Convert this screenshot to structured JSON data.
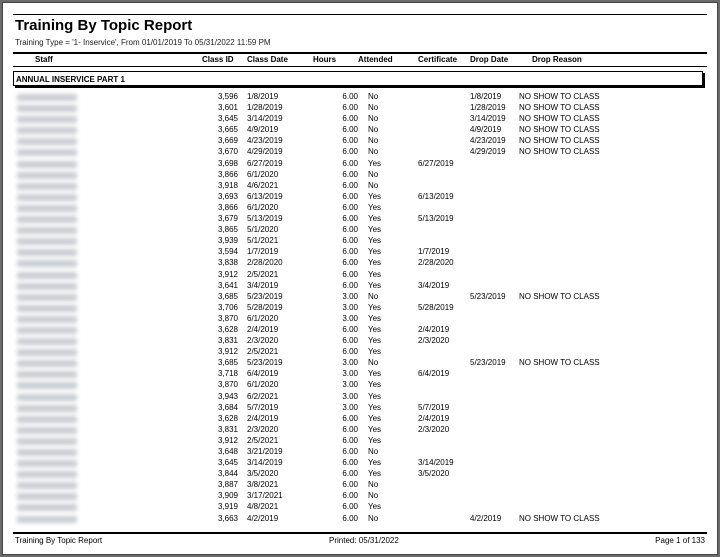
{
  "report": {
    "title": "Training By Topic Report",
    "subtitle": "Training Type  = '1- Inservice', From 01/01/2019 To 05/31/2022 11:59 PM"
  },
  "columns": {
    "staff": "Staff",
    "class_id": "Class ID",
    "class_date": "Class Date",
    "hours": "Hours",
    "attended": "Attended",
    "certificate": "Certificate",
    "drop_date": "Drop Date",
    "drop_reason": "Drop Reason"
  },
  "section": {
    "title": "ANNUAL INSERVICE PART 1"
  },
  "rows": [
    {
      "class_id": "3,596",
      "class_date": "1/8/2019",
      "hours": "6.00",
      "attended": "No",
      "certificate": "",
      "drop_date": "1/8/2019",
      "drop_reason": "NO SHOW TO CLASS"
    },
    {
      "class_id": "3,601",
      "class_date": "1/28/2019",
      "hours": "6.00",
      "attended": "No",
      "certificate": "",
      "drop_date": "1/28/2019",
      "drop_reason": "NO SHOW TO CLASS"
    },
    {
      "class_id": "3,645",
      "class_date": "3/14/2019",
      "hours": "6.00",
      "attended": "No",
      "certificate": "",
      "drop_date": "3/14/2019",
      "drop_reason": "NO SHOW TO CLASS"
    },
    {
      "class_id": "3,665",
      "class_date": "4/9/2019",
      "hours": "6.00",
      "attended": "No",
      "certificate": "",
      "drop_date": "4/9/2019",
      "drop_reason": "NO SHOW TO CLASS"
    },
    {
      "class_id": "3,669",
      "class_date": "4/23/2019",
      "hours": "6.00",
      "attended": "No",
      "certificate": "",
      "drop_date": "4/23/2019",
      "drop_reason": "NO SHOW TO CLASS"
    },
    {
      "class_id": "3,670",
      "class_date": "4/29/2019",
      "hours": "6.00",
      "attended": "No",
      "certificate": "",
      "drop_date": "4/29/2019",
      "drop_reason": "NO SHOW TO CLASS"
    },
    {
      "class_id": "3,698",
      "class_date": "6/27/2019",
      "hours": "6.00",
      "attended": "Yes",
      "certificate": "6/27/2019",
      "drop_date": "",
      "drop_reason": ""
    },
    {
      "class_id": "3,866",
      "class_date": "6/1/2020",
      "hours": "6.00",
      "attended": "No",
      "certificate": "",
      "drop_date": "",
      "drop_reason": ""
    },
    {
      "class_id": "3,918",
      "class_date": "4/6/2021",
      "hours": "6.00",
      "attended": "No",
      "certificate": "",
      "drop_date": "",
      "drop_reason": ""
    },
    {
      "class_id": "3,693",
      "class_date": "6/13/2019",
      "hours": "6.00",
      "attended": "Yes",
      "certificate": "6/13/2019",
      "drop_date": "",
      "drop_reason": ""
    },
    {
      "class_id": "3,866",
      "class_date": "6/1/2020",
      "hours": "6.00",
      "attended": "Yes",
      "certificate": "",
      "drop_date": "",
      "drop_reason": ""
    },
    {
      "class_id": "3,679",
      "class_date": "5/13/2019",
      "hours": "6.00",
      "attended": "Yes",
      "certificate": "5/13/2019",
      "drop_date": "",
      "drop_reason": ""
    },
    {
      "class_id": "3,865",
      "class_date": "5/1/2020",
      "hours": "6.00",
      "attended": "Yes",
      "certificate": "",
      "drop_date": "",
      "drop_reason": ""
    },
    {
      "class_id": "3,939",
      "class_date": "5/1/2021",
      "hours": "6.00",
      "attended": "Yes",
      "certificate": "",
      "drop_date": "",
      "drop_reason": ""
    },
    {
      "class_id": "3,594",
      "class_date": "1/7/2019",
      "hours": "6.00",
      "attended": "Yes",
      "certificate": "1/7/2019",
      "drop_date": "",
      "drop_reason": ""
    },
    {
      "class_id": "3,838",
      "class_date": "2/28/2020",
      "hours": "6.00",
      "attended": "Yes",
      "certificate": "2/28/2020",
      "drop_date": "",
      "drop_reason": ""
    },
    {
      "class_id": "3,912",
      "class_date": "2/5/2021",
      "hours": "6.00",
      "attended": "Yes",
      "certificate": "",
      "drop_date": "",
      "drop_reason": ""
    },
    {
      "class_id": "3,641",
      "class_date": "3/4/2019",
      "hours": "6.00",
      "attended": "Yes",
      "certificate": "3/4/2019",
      "drop_date": "",
      "drop_reason": ""
    },
    {
      "class_id": "3,685",
      "class_date": "5/23/2019",
      "hours": "3.00",
      "attended": "No",
      "certificate": "",
      "drop_date": "5/23/2019",
      "drop_reason": "NO SHOW TO CLASS"
    },
    {
      "class_id": "3,706",
      "class_date": "5/28/2019",
      "hours": "3.00",
      "attended": "Yes",
      "certificate": "5/28/2019",
      "drop_date": "",
      "drop_reason": ""
    },
    {
      "class_id": "3,870",
      "class_date": "6/1/2020",
      "hours": "3.00",
      "attended": "Yes",
      "certificate": "",
      "drop_date": "",
      "drop_reason": ""
    },
    {
      "class_id": "3,628",
      "class_date": "2/4/2019",
      "hours": "6.00",
      "attended": "Yes",
      "certificate": "2/4/2019",
      "drop_date": "",
      "drop_reason": ""
    },
    {
      "class_id": "3,831",
      "class_date": "2/3/2020",
      "hours": "6.00",
      "attended": "Yes",
      "certificate": "2/3/2020",
      "drop_date": "",
      "drop_reason": ""
    },
    {
      "class_id": "3,912",
      "class_date": "2/5/2021",
      "hours": "6.00",
      "attended": "Yes",
      "certificate": "",
      "drop_date": "",
      "drop_reason": ""
    },
    {
      "class_id": "3,685",
      "class_date": "5/23/2019",
      "hours": "3.00",
      "attended": "No",
      "certificate": "",
      "drop_date": "5/23/2019",
      "drop_reason": "NO SHOW TO CLASS"
    },
    {
      "class_id": "3,718",
      "class_date": "6/4/2019",
      "hours": "3.00",
      "attended": "Yes",
      "certificate": "6/4/2019",
      "drop_date": "",
      "drop_reason": ""
    },
    {
      "class_id": "3,870",
      "class_date": "6/1/2020",
      "hours": "3.00",
      "attended": "Yes",
      "certificate": "",
      "drop_date": "",
      "drop_reason": ""
    },
    {
      "class_id": "3,943",
      "class_date": "6/2/2021",
      "hours": "3.00",
      "attended": "Yes",
      "certificate": "",
      "drop_date": "",
      "drop_reason": ""
    },
    {
      "class_id": "3,684",
      "class_date": "5/7/2019",
      "hours": "3.00",
      "attended": "Yes",
      "certificate": "5/7/2019",
      "drop_date": "",
      "drop_reason": ""
    },
    {
      "class_id": "3,628",
      "class_date": "2/4/2019",
      "hours": "6.00",
      "attended": "Yes",
      "certificate": "2/4/2019",
      "drop_date": "",
      "drop_reason": ""
    },
    {
      "class_id": "3,831",
      "class_date": "2/3/2020",
      "hours": "6.00",
      "attended": "Yes",
      "certificate": "2/3/2020",
      "drop_date": "",
      "drop_reason": ""
    },
    {
      "class_id": "3,912",
      "class_date": "2/5/2021",
      "hours": "6.00",
      "attended": "Yes",
      "certificate": "",
      "drop_date": "",
      "drop_reason": ""
    },
    {
      "class_id": "3,648",
      "class_date": "3/21/2019",
      "hours": "6.00",
      "attended": "No",
      "certificate": "",
      "drop_date": "",
      "drop_reason": ""
    },
    {
      "class_id": "3,645",
      "class_date": "3/14/2019",
      "hours": "6.00",
      "attended": "Yes",
      "certificate": "3/14/2019",
      "drop_date": "",
      "drop_reason": ""
    },
    {
      "class_id": "3,844",
      "class_date": "3/5/2020",
      "hours": "6.00",
      "attended": "Yes",
      "certificate": "3/5/2020",
      "drop_date": "",
      "drop_reason": ""
    },
    {
      "class_id": "3,887",
      "class_date": "3/8/2021",
      "hours": "6.00",
      "attended": "No",
      "certificate": "",
      "drop_date": "",
      "drop_reason": ""
    },
    {
      "class_id": "3,909",
      "class_date": "3/17/2021",
      "hours": "6.00",
      "attended": "No",
      "certificate": "",
      "drop_date": "",
      "drop_reason": ""
    },
    {
      "class_id": "3,919",
      "class_date": "4/8/2021",
      "hours": "6.00",
      "attended": "Yes",
      "certificate": "",
      "drop_date": "",
      "drop_reason": ""
    },
    {
      "class_id": "3,663",
      "class_date": "4/2/2019",
      "hours": "6.00",
      "attended": "No",
      "certificate": "",
      "drop_date": "4/2/2019",
      "drop_reason": "NO SHOW TO CLASS"
    }
  ],
  "footer": {
    "left": "Training By Topic Report",
    "center": "Printed: 05/31/2022",
    "right": "Page 1 of 133"
  }
}
